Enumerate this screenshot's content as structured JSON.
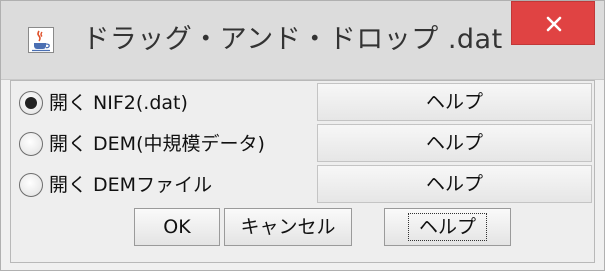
{
  "window": {
    "title": "ドラッグ・アンド・ドロップ .dat",
    "close_symbol": "×",
    "icon": "java-cup-icon"
  },
  "options": [
    {
      "label": "開く NIF2(.dat)",
      "selected": true,
      "help_label": "ヘルプ"
    },
    {
      "label": "開く DEM(中規模データ)",
      "selected": false,
      "help_label": "ヘルプ"
    },
    {
      "label": "開く DEMファイル",
      "selected": false,
      "help_label": "ヘルプ"
    }
  ],
  "buttons": {
    "ok": "OK",
    "cancel": "キャンセル",
    "help": "ヘルプ"
  },
  "colors": {
    "close_button": "#e04343",
    "titlebar": "#dcdcdc",
    "background": "#f0f0f0"
  }
}
